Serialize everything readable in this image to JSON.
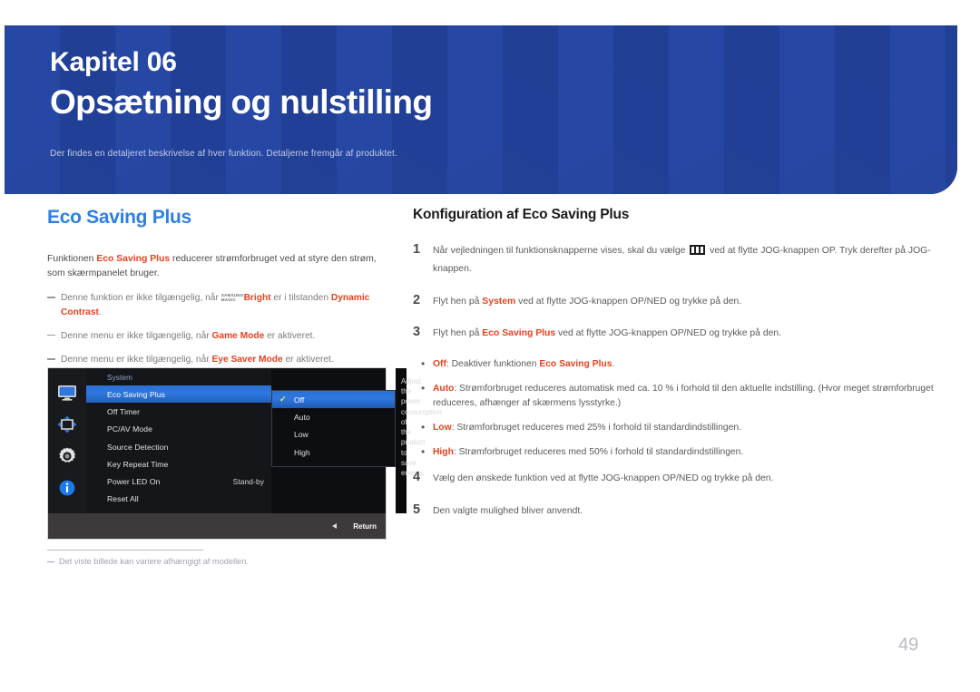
{
  "header": {
    "kicker": "Kapitel 06",
    "title": "Opsætning og nulstilling",
    "subtitle": "Der findes en detaljeret beskrivelse af hver funktion. Detaljerne fremgår af produktet.",
    "band_color": "#23429b"
  },
  "left": {
    "heading": "Eco Saving Plus",
    "heading_color": "#2e7fe4",
    "intro": {
      "pre": "Funktionen ",
      "term": "Eco Saving Plus",
      "post": " reducerer strømforbruget ved at styre den strøm, som skærmpanelet bruger."
    },
    "notes": [
      {
        "pre": "Denne funktion er ikke tilgængelig, når ",
        "logo_top": "SAMSUNG",
        "logo_bottom": "MAGIC",
        "logo_word": "Bright",
        "mid": " er i tilstanden ",
        "term": "Dynamic Contrast",
        "post": "."
      },
      {
        "pre": "Denne menu er ikke tilgængelig, når ",
        "term": "Game Mode",
        "post": " er aktiveret."
      },
      {
        "pre": "Denne menu er ikke tilgængelig, når ",
        "term": "Eye Saver Mode",
        "post": " er aktiveret."
      }
    ],
    "footnote": "Det viste billede kan variere afhængigt af modellen."
  },
  "osd": {
    "icons": [
      "monitor-icon",
      "move-arrows-icon",
      "gear-icon",
      "info-icon"
    ],
    "menu_title": "System",
    "menu_items": [
      {
        "label": "Eco Saving Plus",
        "value": "",
        "selected": true
      },
      {
        "label": "Off Timer",
        "value": "",
        "selected": false
      },
      {
        "label": "PC/AV Mode",
        "value": "",
        "selected": false
      },
      {
        "label": "Source Detection",
        "value": "",
        "selected": false
      },
      {
        "label": "Key Repeat Time",
        "value": "",
        "selected": false
      },
      {
        "label": "Power LED On",
        "value": "Stand-by",
        "selected": false
      },
      {
        "label": "Reset All",
        "value": "",
        "selected": false
      }
    ],
    "submenu_items": [
      {
        "label": "Off",
        "selected": true
      },
      {
        "label": "Auto",
        "selected": false
      },
      {
        "label": "Low",
        "selected": false
      },
      {
        "label": "High",
        "selected": false
      }
    ],
    "description": "Adjust the power consumption of the product to save energy.",
    "return_label": "Return",
    "highlight_color": "#2e78e0",
    "check_color": "#f2e93c"
  },
  "right": {
    "heading": "Konfiguration af Eco Saving Plus",
    "steps": [
      {
        "num": "1",
        "pre": "Når vejledningen til funktionsknapperne vises, skal du vælge ",
        "icon": "menu-bars-icon",
        "post": " ved at flytte JOG-knappen OP. Tryk derefter på JOG-knappen."
      },
      {
        "num": "2",
        "pre": "Flyt hen på ",
        "term": "System",
        "post": " ved at flytte JOG-knappen OP/NED og trykke på den."
      },
      {
        "num": "3",
        "pre": "Flyt hen på ",
        "term": "Eco Saving Plus",
        "post": " ved at flytte JOG-knappen OP/NED og trykke på den."
      }
    ],
    "bullets": [
      {
        "term": "Off",
        "mid": ": Deaktiver funktionen ",
        "term2": "Eco Saving Plus",
        "post": "."
      },
      {
        "term": "Auto",
        "mid": ": Strømforbruget reduceres automatisk med ca. 10 % i forhold til den aktuelle indstilling. (Hvor meget strømforbruget reduceres, afhænger af skærmens lysstyrke.)"
      },
      {
        "term": "Low",
        "mid": ": Strømforbruget reduceres med 25% i forhold til standardindstillingen."
      },
      {
        "term": "High",
        "mid": ": Strømforbruget reduceres med 50% i forhold til standardindstillingen."
      }
    ],
    "steps_after": [
      {
        "num": "4",
        "text": "Vælg den ønskede funktion ved at flytte JOG-knappen OP/NED og trykke på den."
      },
      {
        "num": "5",
        "text": "Den valgte mulighed bliver anvendt."
      }
    ]
  },
  "page_number": "49"
}
